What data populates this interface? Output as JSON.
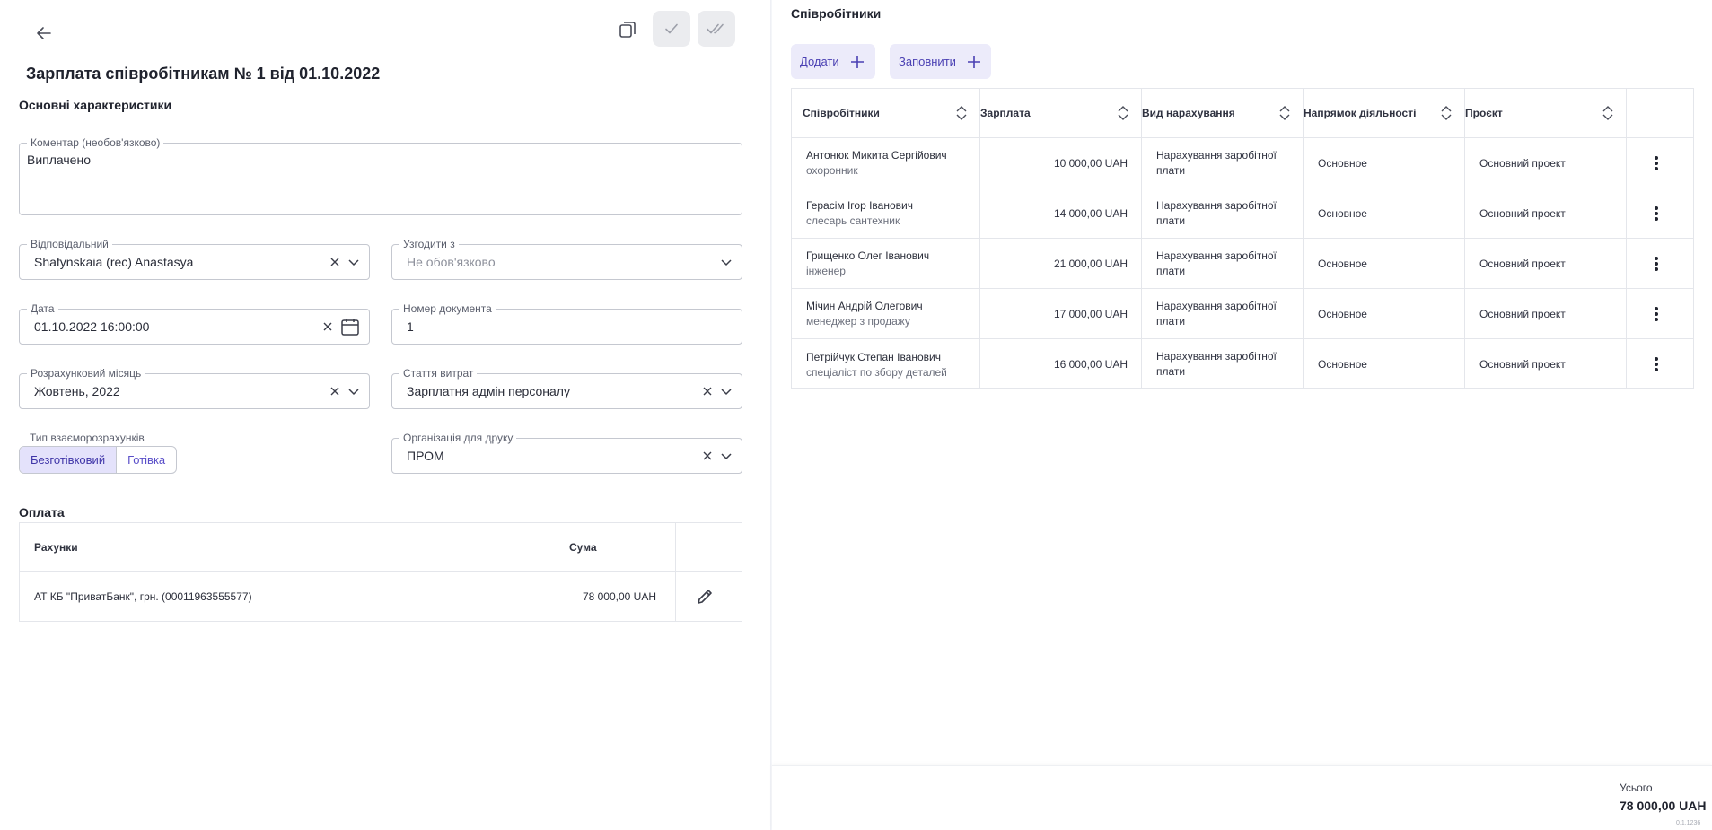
{
  "header": {
    "title": "Зарплата співробітникам № 1 від 01.10.2022"
  },
  "sections": {
    "main": "Основні характеристики",
    "payment": "Оплата"
  },
  "form": {
    "comment": {
      "label": "Коментар (необов'язково)",
      "value": "Виплачено"
    },
    "responsible": {
      "label": "Відповідальний",
      "value": "Shafynskaia (rec) Anastasya"
    },
    "approve": {
      "label": "Узгодити з",
      "placeholder": "Не обов'язково"
    },
    "date": {
      "label": "Дата",
      "value": "01.10.2022 16:00:00"
    },
    "doc_number": {
      "label": "Номер документа",
      "value": "1"
    },
    "month": {
      "label": "Розрахунковий місяць",
      "value": "Жовтень, 2022"
    },
    "expense": {
      "label": "Стаття витрат",
      "value": "Зарплатня адмін персоналу"
    },
    "settlement_type": {
      "label": "Тип взаєморозрахунків",
      "options": [
        "Безготівковий",
        "Готівка"
      ],
      "selected": "Безготівковий"
    },
    "org_print": {
      "label": "Організація для друку",
      "value": "ПРОМ"
    }
  },
  "payment_table": {
    "columns": [
      "Рахунки",
      "Сума"
    ],
    "rows": [
      {
        "account": "АТ КБ \"ПриватБанк\", грн. (00011963555577)",
        "amount": "78 000,00 UAH"
      }
    ]
  },
  "employees": {
    "title": "Співробітники",
    "add_label": "Додати",
    "fill_label": "Заповнити",
    "columns": [
      "Співробітники",
      "Зарплата",
      "Вид нарахування",
      "Напрямок діяльності",
      "Проєкт"
    ],
    "rows": [
      {
        "name": "Антонюк  Микита Сергійович",
        "position": "охоронник",
        "salary": "10 000,00 UAH",
        "kind": "Нарахування заробітної плати",
        "direction": "Основное",
        "project": "Основний проект"
      },
      {
        "name": "Герасім Ігор Іванович",
        "position": "слесарь сантехник",
        "salary": "14 000,00 UAH",
        "kind": "Нарахування заробітної плати",
        "direction": "Основное",
        "project": "Основний проект"
      },
      {
        "name": "Грищенко Олег Іванович",
        "position": "інженер",
        "salary": "21 000,00 UAH",
        "kind": "Нарахування заробітної плати",
        "direction": "Основное",
        "project": "Основний проект"
      },
      {
        "name": "Мічин Андрій Олегович",
        "position": "менеджер з продажу",
        "salary": "17 000,00 UAH",
        "kind": "Нарахування заробітної плати",
        "direction": "Основное",
        "project": "Основний проект"
      },
      {
        "name": "Петрійчук Степан Іванович",
        "position": "спеціаліст по збору деталей",
        "salary": "16 000,00 UAH",
        "kind": "Нарахування заробітної плати",
        "direction": "Основное",
        "project": "Основний проект"
      }
    ]
  },
  "footer": {
    "total_label": "Усього",
    "total_value": "78 000,00 UAH",
    "version": "0.1.1236"
  },
  "colors": {
    "accent": "#4a40b3",
    "accent_bg": "#ecebfa",
    "border": "#c5c8d0"
  }
}
